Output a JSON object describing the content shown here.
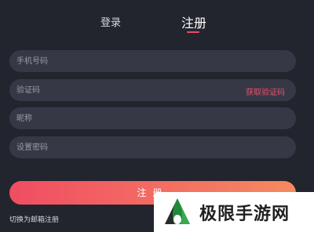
{
  "tabs": {
    "login_label": "登录",
    "register_label": "注册",
    "active": "register"
  },
  "form": {
    "phone_placeholder": "手机号码",
    "code_placeholder": "验证码",
    "get_code_label": "获取验证码",
    "nickname_placeholder": "昵称",
    "password_placeholder": "设置密码",
    "submit_label": "注册",
    "switch_label": "切换为邮箱注册"
  },
  "watermark": {
    "text": "极限手游网"
  },
  "colors": {
    "background": "#23252e",
    "field": "#363945",
    "accent": "#ea4a68",
    "button_gradient": [
      "#f04d62",
      "#f58a5f"
    ]
  }
}
